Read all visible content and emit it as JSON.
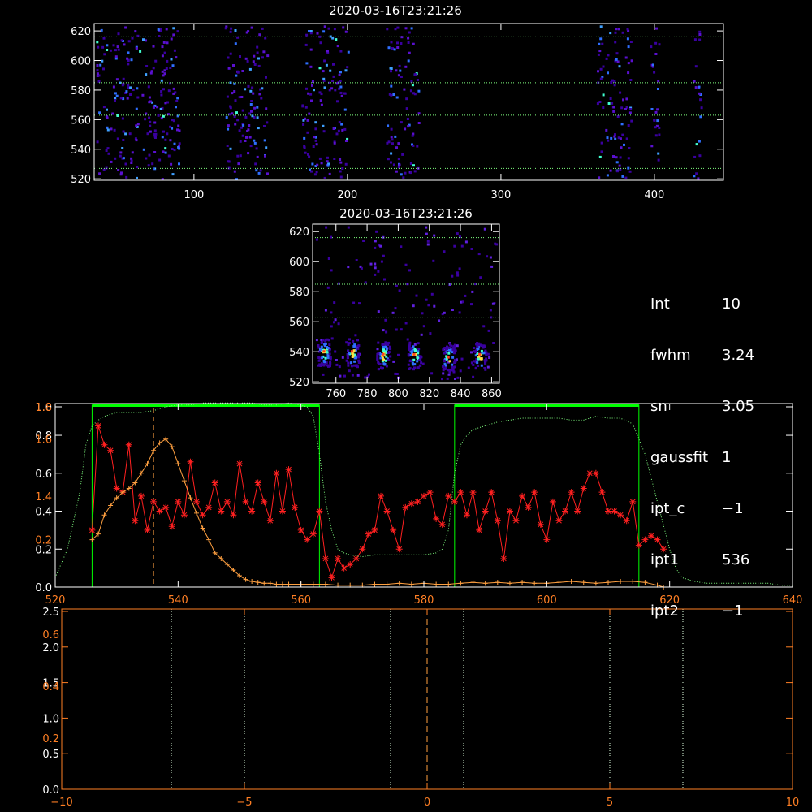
{
  "info_panel": {
    "rows": [
      {
        "key": "Int",
        "value": "10"
      },
      {
        "key": "fwhm",
        "value": "3.24"
      },
      {
        "key": "sn",
        "value": "3.05"
      },
      {
        "key": "gaussfit",
        "value": "1"
      },
      {
        "key": "ipt_c",
        "value": "−1"
      },
      {
        "key": "ipt1",
        "value": "536"
      },
      {
        "key": "ipt2",
        "value": "−1"
      }
    ]
  },
  "colors": {
    "axis_white": "#ffffff",
    "axis_orange": "#ff7f24",
    "red_series": "#ff2020",
    "orange_series": "#ffa040",
    "green_band": "#00ff00",
    "green_dotted": "#80ff80",
    "image_low": "#3a00a0",
    "image_mid": "#2f6fff",
    "image_high": "#40ffd0"
  },
  "chart_data": [
    {
      "id": "top_image",
      "type": "heatmap",
      "title": "2020-03-16T23:21:26",
      "xlim": [
        35,
        445
      ],
      "ylim": [
        519,
        625
      ],
      "xticks": [
        100,
        200,
        300,
        400
      ],
      "yticks": [
        520,
        540,
        560,
        580,
        600,
        620
      ],
      "hlines": [
        527,
        563,
        585,
        616
      ],
      "bands": [
        [
          36,
          90
        ],
        [
          120,
          148
        ],
        [
          170,
          200
        ],
        [
          225,
          246
        ],
        [
          362,
          385
        ],
        [
          397,
          403
        ],
        [
          425,
          430
        ]
      ]
    },
    {
      "id": "zoom_image",
      "type": "heatmap",
      "title": "2020-03-16T23:21:26",
      "xlim": [
        745,
        865
      ],
      "ylim": [
        519,
        625
      ],
      "xticks": [
        760,
        780,
        800,
        820,
        840,
        860
      ],
      "yticks": [
        520,
        540,
        560,
        580,
        600,
        620
      ],
      "hlines": [
        563,
        585,
        616
      ],
      "bright_blobs": [
        [
          752,
          540
        ],
        [
          770,
          540
        ],
        [
          790,
          538
        ],
        [
          810,
          538
        ],
        [
          832,
          536
        ],
        [
          852,
          538
        ]
      ]
    },
    {
      "id": "spectrum",
      "type": "line",
      "xlim": [
        520,
        640
      ],
      "xticks": [
        520,
        540,
        560,
        580,
        600,
        620,
        640
      ],
      "left_axis_white": {
        "ylim": [
          0,
          0.95
        ],
        "ticks": [
          "0.0",
          "0.2",
          "0.4",
          "0.6",
          "0.8",
          "1.0"
        ],
        "tick_values": [
          0,
          0.2,
          0.4,
          0.6,
          0.8,
          0.95
        ]
      },
      "left_axis_orange": {
        "ylim": [
          1.0,
          1.8
        ],
        "ticks": [
          "0.2",
          "1.4",
          "1.6",
          "1.8"
        ],
        "tick_values": [
          0.25,
          0.48,
          0.78,
          0.95
        ]
      },
      "green_boxes": [
        [
          526,
          563
        ],
        [
          585,
          615
        ]
      ],
      "peak_marker_x": 536,
      "series": [
        {
          "color": "red",
          "marker": "star",
          "x": [
            526,
            527,
            528,
            529,
            530,
            531,
            532,
            533,
            534,
            535,
            536,
            537,
            538,
            539,
            540,
            541,
            542,
            543,
            544,
            545,
            546,
            547,
            548,
            549,
            550,
            551,
            552,
            553,
            554,
            555,
            556,
            557,
            558,
            559,
            560,
            561,
            562,
            563,
            564,
            565,
            566,
            567,
            568,
            569,
            570,
            571,
            572,
            573,
            574,
            575,
            576,
            577,
            578,
            579,
            580,
            581,
            582,
            583,
            584,
            585,
            586,
            587,
            588,
            589,
            590,
            591,
            592,
            593,
            594,
            595,
            596,
            597,
            598,
            599,
            600,
            601,
            602,
            603,
            604,
            605,
            606,
            607,
            608,
            609,
            610,
            611,
            612,
            613,
            614,
            615,
            616,
            617,
            618,
            619
          ],
          "y": [
            0.3,
            0.85,
            0.75,
            0.72,
            0.52,
            0.5,
            0.75,
            0.35,
            0.48,
            0.3,
            0.45,
            0.4,
            0.42,
            0.32,
            0.45,
            0.38,
            0.66,
            0.45,
            0.38,
            0.42,
            0.55,
            0.4,
            0.45,
            0.38,
            0.65,
            0.45,
            0.4,
            0.55,
            0.45,
            0.35,
            0.6,
            0.4,
            0.62,
            0.42,
            0.3,
            0.25,
            0.28,
            0.4,
            0.15,
            0.05,
            0.15,
            0.1,
            0.12,
            0.15,
            0.2,
            0.28,
            0.3,
            0.48,
            0.4,
            0.3,
            0.2,
            0.42,
            0.44,
            0.45,
            0.48,
            0.5,
            0.36,
            0.33,
            0.48,
            0.45,
            0.5,
            0.38,
            0.5,
            0.3,
            0.4,
            0.5,
            0.35,
            0.15,
            0.4,
            0.35,
            0.48,
            0.42,
            0.5,
            0.33,
            0.25,
            0.45,
            0.35,
            0.4,
            0.5,
            0.4,
            0.52,
            0.6,
            0.6,
            0.5,
            0.4,
            0.4,
            0.38,
            0.35,
            0.45,
            0.22,
            0.25,
            0.27,
            0.25,
            0.2
          ]
        },
        {
          "color": "orange",
          "marker": "plus",
          "x": [
            526,
            527,
            528,
            529,
            530,
            531,
            532,
            533,
            534,
            535,
            536,
            537,
            538,
            539,
            540,
            541,
            542,
            543,
            544,
            545,
            546,
            547,
            548,
            549,
            550,
            551,
            552,
            553,
            554,
            555,
            556,
            557,
            558,
            560,
            562,
            564,
            566,
            568,
            570,
            572,
            574,
            576,
            578,
            580,
            582,
            584,
            586,
            588,
            590,
            592,
            594,
            596,
            598,
            600,
            602,
            604,
            606,
            608,
            610,
            612,
            614,
            616,
            618,
            619
          ],
          "y": [
            0.25,
            0.28,
            0.38,
            0.43,
            0.47,
            0.5,
            0.52,
            0.55,
            0.6,
            0.65,
            0.72,
            0.76,
            0.78,
            0.74,
            0.65,
            0.56,
            0.47,
            0.39,
            0.31,
            0.25,
            0.18,
            0.15,
            0.12,
            0.09,
            0.06,
            0.04,
            0.03,
            0.025,
            0.02,
            0.02,
            0.015,
            0.015,
            0.015,
            0.015,
            0.015,
            0.015,
            0.01,
            0.01,
            0.01,
            0.015,
            0.015,
            0.02,
            0.015,
            0.02,
            0.015,
            0.015,
            0.02,
            0.025,
            0.02,
            0.025,
            0.02,
            0.025,
            0.02,
            0.02,
            0.025,
            0.03,
            0.025,
            0.02,
            0.025,
            0.03,
            0.03,
            0.025,
            0.01,
            0.0
          ]
        },
        {
          "color": "green-dotted",
          "x": [
            520,
            522,
            524,
            525,
            526,
            527,
            528,
            530,
            532,
            534,
            536,
            538,
            540,
            542,
            544,
            546,
            548,
            550,
            552,
            554,
            556,
            558,
            560,
            561,
            562,
            563,
            564,
            565,
            566,
            567,
            568,
            570,
            572,
            574,
            576,
            578,
            580,
            582,
            583,
            584,
            585,
            586,
            587,
            588,
            590,
            592,
            594,
            596,
            598,
            600,
            602,
            604,
            606,
            608,
            610,
            612,
            614,
            616,
            618,
            620,
            621,
            622,
            624,
            626,
            628,
            630,
            632,
            634,
            636,
            638,
            640
          ],
          "y": [
            0.05,
            0.2,
            0.5,
            0.75,
            0.85,
            0.88,
            0.9,
            0.92,
            0.92,
            0.92,
            0.93,
            0.95,
            0.96,
            0.96,
            0.97,
            0.97,
            0.97,
            0.97,
            0.97,
            0.96,
            0.96,
            0.97,
            0.96,
            0.95,
            0.9,
            0.7,
            0.45,
            0.3,
            0.2,
            0.18,
            0.17,
            0.16,
            0.17,
            0.17,
            0.17,
            0.17,
            0.17,
            0.18,
            0.2,
            0.3,
            0.6,
            0.75,
            0.8,
            0.83,
            0.85,
            0.87,
            0.88,
            0.89,
            0.89,
            0.89,
            0.89,
            0.88,
            0.88,
            0.9,
            0.89,
            0.89,
            0.86,
            0.7,
            0.45,
            0.2,
            0.1,
            0.05,
            0.03,
            0.02,
            0.02,
            0.02,
            0.02,
            0.02,
            0.02,
            0.01,
            0.01
          ]
        }
      ]
    },
    {
      "id": "bottom_panel",
      "type": "line",
      "xlim": [
        -10,
        10
      ],
      "xticks": [
        -10,
        -5,
        0,
        5,
        10
      ],
      "left_axis_white": {
        "ylim": [
          0,
          2.5
        ],
        "ticks": [
          "0.0",
          "0.5",
          "1.0",
          "1.5",
          "2.0",
          "2.5"
        ],
        "tick_values": [
          0,
          0.5,
          1.0,
          1.5,
          2.0,
          2.5
        ]
      },
      "left_axis_orange": {
        "ticks": [
          "0.2",
          "0.4",
          "0.6"
        ],
        "tick_values": [
          0.72,
          1.45,
          2.18
        ]
      },
      "dotted_vlines": [
        -7,
        -5,
        -1,
        1,
        5,
        7
      ],
      "dashed_vline": 0,
      "series": []
    }
  ]
}
